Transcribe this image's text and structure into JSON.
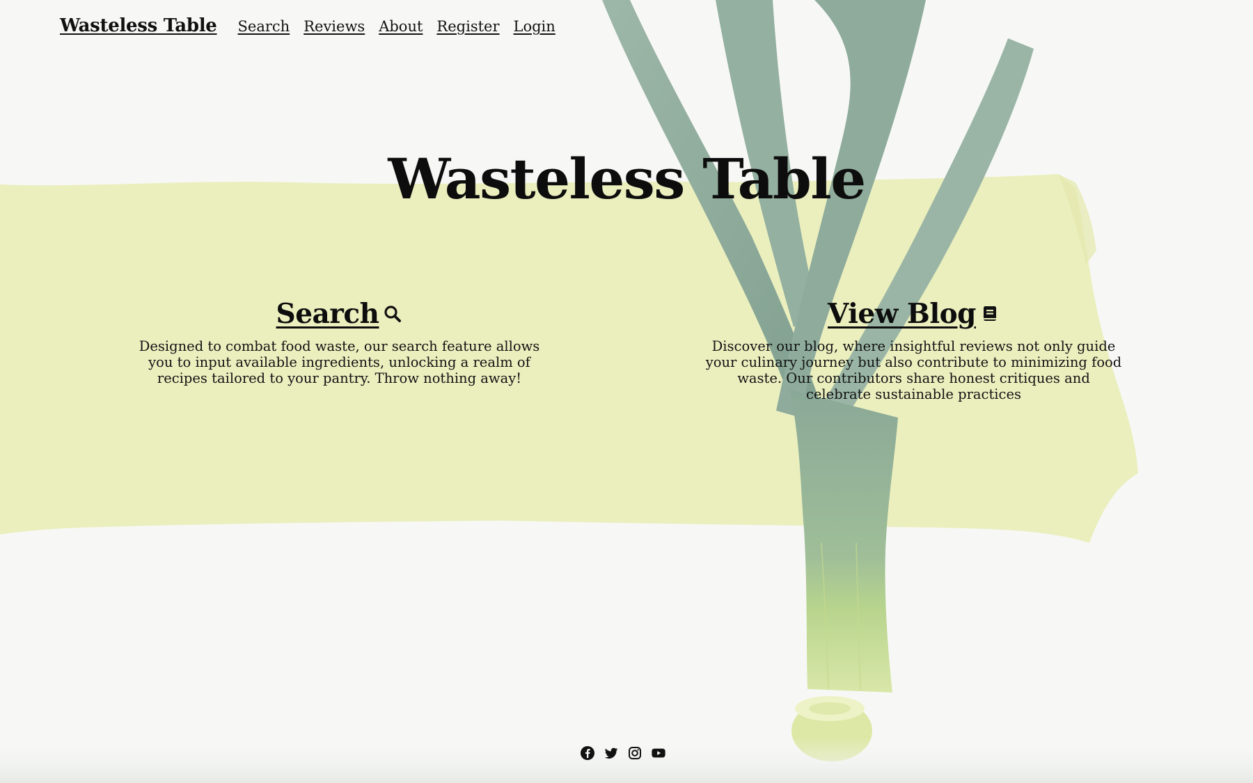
{
  "navbar": {
    "brand": "Wasteless Table",
    "links": [
      "Search",
      "Reviews",
      "About",
      "Register",
      "Login"
    ]
  },
  "hero": {
    "title": "Wasteless Table"
  },
  "features": {
    "search": {
      "heading": "Search",
      "icon": "magnifier-icon",
      "description": "Designed to combat food waste, our search feature allows you to input available ingredients, unlocking a realm of recipes tailored to your pantry. Throw nothing away!"
    },
    "blog": {
      "heading": "View Blog",
      "icon": "book-icon",
      "description": "Discover our blog, where insightful reviews not only guide your culinary journey but also contribute to minimizing food waste. Our contributors share honest critiques and celebrate sustainable practices"
    }
  },
  "footer": {
    "social_icons": [
      "facebook-icon",
      "twitter-icon",
      "instagram-icon",
      "youtube-icon"
    ]
  },
  "colors": {
    "background": "#f7f8f6",
    "brush_band": "#eaeeba",
    "leek_dark": "#8fae9c",
    "leek_light": "#cfe09a",
    "text": "#111111"
  }
}
